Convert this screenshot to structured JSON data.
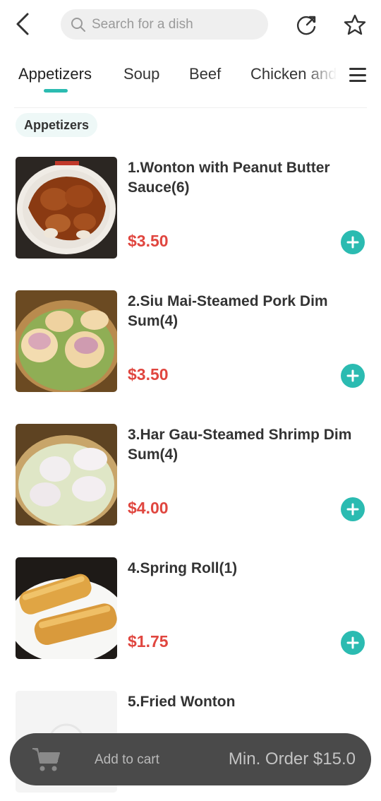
{
  "header": {
    "search_placeholder": "Search for a dish",
    "icons": {
      "back": "back-arrow-icon",
      "search": "search-icon",
      "share": "share-icon",
      "favorite": "star-icon"
    }
  },
  "tabs": [
    {
      "label": "Appetizers",
      "active": true
    },
    {
      "label": "Soup",
      "active": false
    },
    {
      "label": "Beef",
      "active": false
    },
    {
      "label": "Chicken and",
      "active": false
    }
  ],
  "accent_color": "#2bbbb1",
  "price_color": "#e0463f",
  "section": {
    "title": "Appetizers"
  },
  "items": [
    {
      "name": "1.Wonton with Peanut Butter Sauce(6)",
      "price": "$3.50"
    },
    {
      "name": "2.Siu Mai-Steamed Pork Dim Sum(4)",
      "price": "$3.50"
    },
    {
      "name": "3.Har Gau-Steamed Shrimp Dim Sum(4)",
      "price": "$4.00"
    },
    {
      "name": "4.Spring Roll(1)",
      "price": "$1.75"
    },
    {
      "name": "5.Fried Wonton",
      "price": ""
    }
  ],
  "cart": {
    "add_label": "Add to cart",
    "min_order": "Min. Order $15.0"
  }
}
